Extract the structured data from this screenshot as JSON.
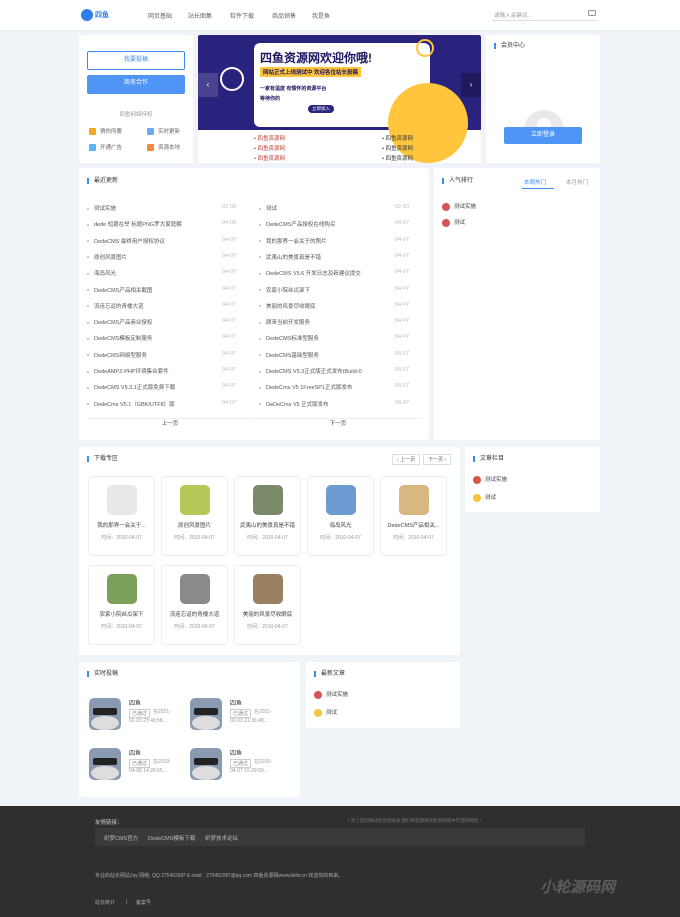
{
  "header": {
    "logo": "四鱼",
    "nav": [
      "网页基础",
      "站长图集",
      "软件下载",
      "商品销售",
      "我是鱼"
    ],
    "search_placeholder": "请输入关键词..."
  },
  "user_panel": {
    "login": "我要投稿",
    "cooperate": "商务合作",
    "section_title": "四鱼网络特权",
    "perks": [
      "猜你所要",
      "实时更新",
      "开通广告",
      "资源本地"
    ]
  },
  "banner": {
    "headline": "四鱼资源网欢迎你哦!",
    "subline": "网站正式上线测试中 欢迎各位站长投稿",
    "bullet1": "一家有温度 有情怀的资源平台",
    "bullet2": "等待你的",
    "button": "立即加入"
  },
  "banner_links": {
    "left": [
      "四鱼资源网",
      "四鱼资源网",
      "四鱼资源网"
    ],
    "right": [
      "四鱼资源网",
      "四鱼资源网",
      "四鱼资源网"
    ]
  },
  "member": {
    "title": "会员中心",
    "login_button": "立即登录"
  },
  "latest": {
    "title": "最近更新",
    "left": [
      {
        "t": "测试实施",
        "d": "02-03"
      },
      {
        "t": "dede 短篇在举 标题PNG罗大家庭解",
        "d": "04-08"
      },
      {
        "t": "DedeCMS 最终用户授权协议",
        "d": "04-07"
      },
      {
        "t": "原创风景图片",
        "d": "04-07"
      },
      {
        "t": "海岛风光",
        "d": "04-07"
      },
      {
        "t": "DedeCMS产品相关截图",
        "d": "04-07"
      },
      {
        "t": "流连忘返的青楼大道",
        "d": "04-07"
      },
      {
        "t": "DedeCMS产品商业授权",
        "d": "04-07"
      },
      {
        "t": "DedeCMS模板定制服务",
        "d": "04-07"
      },
      {
        "t": "DedeCMS网络型服务",
        "d": "04-07"
      },
      {
        "t": "DedeAMPZ-PHP环境集合套件",
        "d": "04-07"
      },
      {
        "t": "DedeCMS V5.3.1正式版免费下载",
        "d": "04-07"
      },
      {
        "t": "DedeCms V5.1（GBK/UTF8）版",
        "d": "04-07"
      }
    ],
    "right": [
      {
        "t": "测试",
        "d": "02-03"
      },
      {
        "t": "DedeCMS产品授权在线购买",
        "d": "04-07"
      },
      {
        "t": "我的那界一会关于的照片",
        "d": "04-07"
      },
      {
        "t": "武夷山的美景真是不错",
        "d": "04-07"
      },
      {
        "t": "DedeCMS V5.6 开发日志及新建议提交",
        "d": "04-07"
      },
      {
        "t": "农家小院丝瓜架下",
        "d": "04-07"
      },
      {
        "t": "美丽的风景尽收眼底",
        "d": "04-07"
      },
      {
        "t": "顾来当前开发服务",
        "d": "04-07"
      },
      {
        "t": "DedeCMS标准型服务",
        "d": "04-07"
      },
      {
        "t": "DedeCMS基础型服务",
        "d": "04-07"
      },
      {
        "t": "DedeCMS V5.3正式版正式发布(Build-0",
        "d": "04-07"
      },
      {
        "t": "DedeCms V5 1FreeSP1正式版发布",
        "d": "04-07"
      },
      {
        "t": "DeDeCms V5 正式版发布",
        "d": "04-07"
      }
    ],
    "prev": "上一页",
    "next": "下一页"
  },
  "popular": {
    "title": "人气排行",
    "tab_month": "本周热门",
    "tab_week": "本月热门",
    "items": [
      "测试实施",
      "测试"
    ]
  },
  "downloads": {
    "title": "下载专区",
    "prev": "上一页",
    "next": "下一页",
    "items": [
      {
        "t": "我的那界一会关于...",
        "d": "时间：2010-04-07"
      },
      {
        "t": "原创风景图片",
        "d": "时间：2010-04-07"
      },
      {
        "t": "武夷山的美景真是不错",
        "d": "时间：2010-04-07"
      },
      {
        "t": "海岛风光",
        "d": "时间：2010-04-07"
      },
      {
        "t": "DedeCMS产品相关...",
        "d": "时间：2010-04-07"
      },
      {
        "t": "农家小院丝瓜架下",
        "d": "时间：2010-04-07"
      },
      {
        "t": "流连忘返的青楼大道",
        "d": "时间：2010-04-07"
      },
      {
        "t": "美丽的风景尽收眼底",
        "d": "时间：2010-04-07"
      }
    ]
  },
  "article_col": {
    "title": "文章栏目",
    "items": [
      "测试实施",
      "测试"
    ]
  },
  "contrib": {
    "title": "实时投稿",
    "items": [
      {
        "name": "四鱼",
        "status": "已通过",
        "time": "在2021-02-03 23:40:58..."
      },
      {
        "name": "四鱼",
        "status": "已通过",
        "time": "在2021-02-03 21:36:48..."
      },
      {
        "name": "四鱼",
        "status": "已通过",
        "time": "在2010-04-08 14:28:55..."
      },
      {
        "name": "四鱼",
        "status": "已通过",
        "time": "在2010-04-07 15:29:59..."
      }
    ]
  },
  "newest": {
    "title": "最新文章",
    "items": [
      "测试实施",
      "测试"
    ]
  },
  "footer": {
    "links_title": "友情链接：",
    "links_note": "（ 为了您的网站在优化收录 我们将定期清除友情链接中不活跃网站 ）",
    "links": [
      "织梦CMS官方",
      "DedeCMS模板下载",
      "织梦技术论坛"
    ],
    "contact": "专业的站长网站Jay 网络; QQ 2754529ll7 E-mail：2754529ll7@qq.com 四鱼资源网www.kkfw.cn 欢迎你的到来。",
    "bottom": [
      "站长统计",
      "备案号"
    ],
    "watermark": "小轮源码网"
  },
  "colors": {
    "accent": "#3c8cf0",
    "banner_bg": "#2a237d",
    "banner_yellow": "#ffc53d",
    "rank_red": "#d9534f",
    "rank_yellow": "#f5c342"
  }
}
